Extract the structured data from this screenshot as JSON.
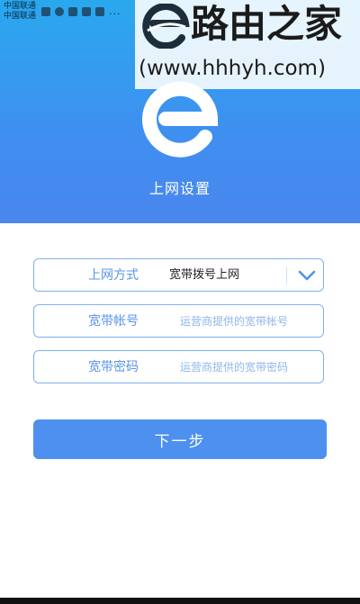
{
  "status_bar": {
    "carrier_1": "中国联通",
    "carrier_2": "中国联通",
    "more": "..."
  },
  "watermark": {
    "title": "路由之家",
    "url": "(www.hhhyh.com)"
  },
  "header": {
    "title": "上网设置",
    "logo_icon": "e-logo-icon"
  },
  "form": {
    "connection_type": {
      "label": "上网方式",
      "value": "宽带拨号上网",
      "icon": "chevron-down-icon"
    },
    "account": {
      "label": "宽带帐号",
      "placeholder": "运营商提供的宽带帐号"
    },
    "password": {
      "label": "宽带密码",
      "placeholder": "运营商提供的宽带密码"
    }
  },
  "next_button": {
    "label": "下一步"
  },
  "colors": {
    "header_top": "#2aa8ee",
    "header_bottom": "#4a86ee",
    "accent": "#4d90f0",
    "label": "#5a94e6",
    "border": "#7fb0ef"
  }
}
